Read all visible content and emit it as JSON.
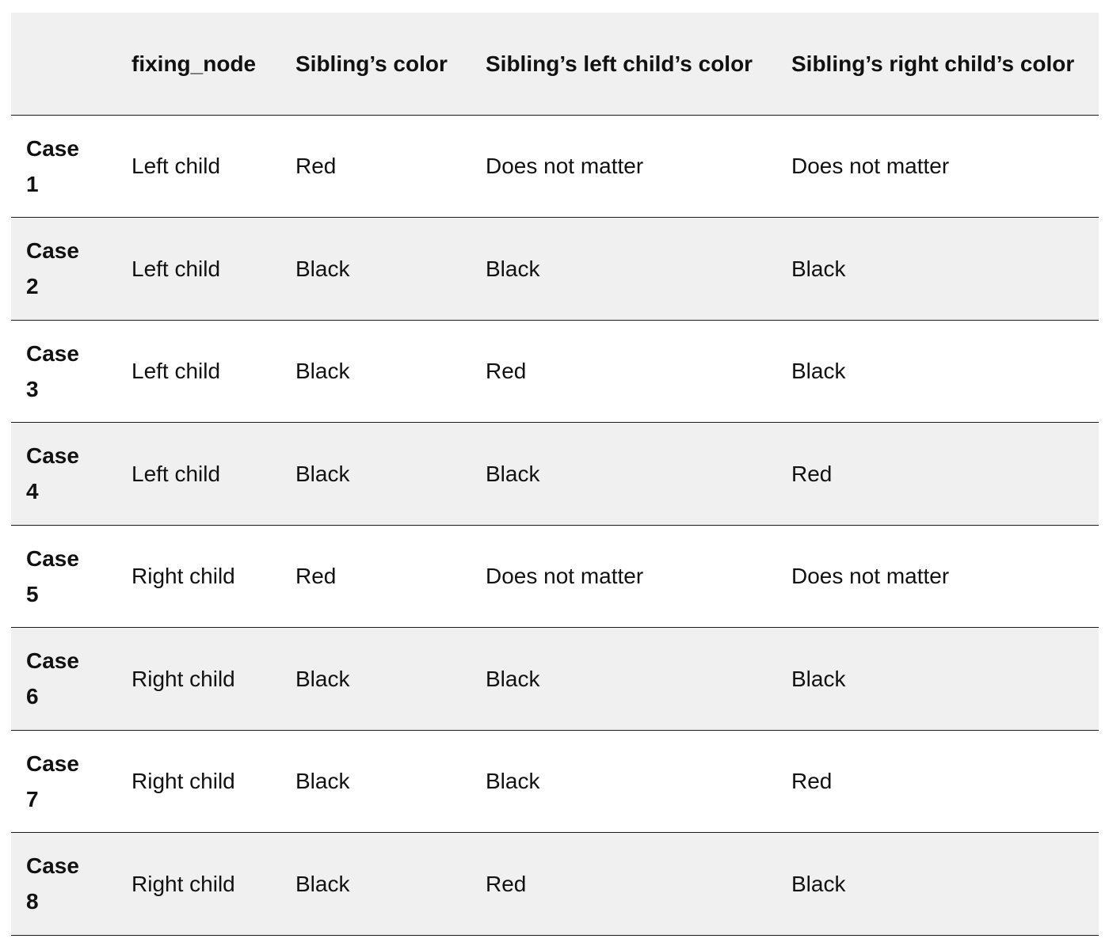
{
  "table": {
    "headers": [
      "",
      "fixing_node",
      "Sibling’s color",
      "Sibling’s left child’s color",
      "Sibling’s right child’s color"
    ],
    "rows": [
      {
        "case": "Case 1",
        "fixing_node": "Left child",
        "sibling_color": "Red",
        "left_child_color": "Does not matter",
        "right_child_color": "Does not matter"
      },
      {
        "case": "Case 2",
        "fixing_node": "Left child",
        "sibling_color": "Black",
        "left_child_color": "Black",
        "right_child_color": "Black"
      },
      {
        "case": "Case 3",
        "fixing_node": "Left child",
        "sibling_color": "Black",
        "left_child_color": "Red",
        "right_child_color": "Black"
      },
      {
        "case": "Case 4",
        "fixing_node": "Left child",
        "sibling_color": "Black",
        "left_child_color": "Black",
        "right_child_color": "Red"
      },
      {
        "case": "Case 5",
        "fixing_node": "Right child",
        "sibling_color": "Red",
        "left_child_color": "Does not matter",
        "right_child_color": "Does not matter"
      },
      {
        "case": "Case 6",
        "fixing_node": "Right child",
        "sibling_color": "Black",
        "left_child_color": "Black",
        "right_child_color": "Black"
      },
      {
        "case": "Case 7",
        "fixing_node": "Right child",
        "sibling_color": "Black",
        "left_child_color": "Black",
        "right_child_color": "Red"
      },
      {
        "case": "Case 8",
        "fixing_node": "Right child",
        "sibling_color": "Black",
        "left_child_color": "Red",
        "right_child_color": "Black"
      }
    ]
  },
  "colors": {
    "header_bg": "#f0f0f0",
    "shaded_row_bg": "#f0f0f0",
    "row_bg": "#ffffff",
    "border": "#1a1a1a",
    "text": "#111111"
  }
}
